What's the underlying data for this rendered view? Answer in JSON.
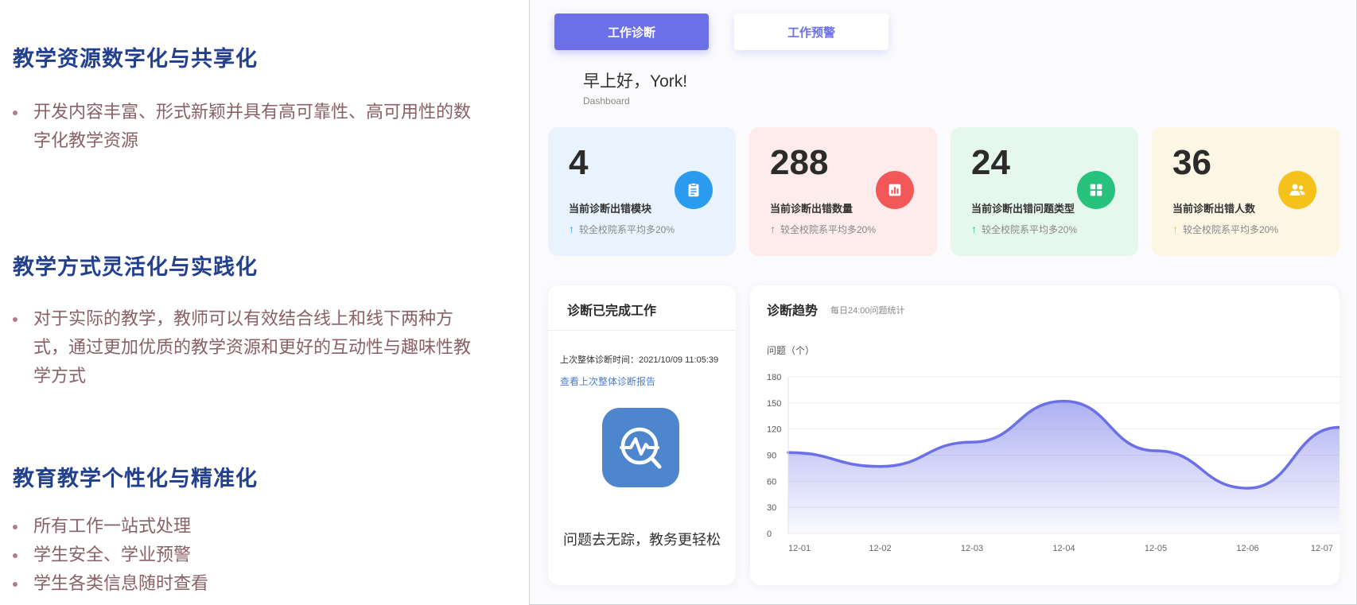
{
  "left": {
    "sections": [
      {
        "title": "教学资源数字化与共享化",
        "bullets": [
          "开发内容丰富、形式新颖并具有高可靠性、高可用性的数字化教学资源"
        ]
      },
      {
        "title": "教学方式灵活化与实践化",
        "bullets": [
          "对于实际的教学，教师可以有效结合线上和线下两种方式，通过更加优质的教学资源和更好的互动性与趣味性教学方式"
        ]
      },
      {
        "title": "教育教学个性化与精准化",
        "bullets": [
          "所有工作一站式处理",
          "学生安全、学业预警",
          "学生各类信息随时查看"
        ]
      }
    ]
  },
  "dashboard": {
    "tabs": [
      {
        "label": "工作诊断",
        "active": true
      },
      {
        "label": "工作预警",
        "active": false
      }
    ],
    "greeting": "早上好，York!",
    "greeting_sub": "Dashboard",
    "stats": [
      {
        "value": "4",
        "label": "当前诊断出错模块",
        "sub": "较全校院系平均多20%",
        "arrow": "↑",
        "icon": "clipboard-icon",
        "bg": "#e8f3fd",
        "accent": "#2b9bf0"
      },
      {
        "value": "288",
        "label": "当前诊断出错数量",
        "sub": "较全校院系平均多20%",
        "arrow": "↑",
        "icon": "bar-chart-icon",
        "bg": "#fdeceb",
        "accent": "#f25858"
      },
      {
        "value": "24",
        "label": "当前诊断出错问题类型",
        "sub": "较全校院系平均多20%",
        "arrow": "↑",
        "icon": "grid-icon",
        "bg": "#e6f7ee",
        "accent": "#27c27e"
      },
      {
        "value": "36",
        "label": "当前诊断出错人数",
        "sub": "较全校院系平均多20%",
        "arrow": "↑",
        "icon": "users-icon",
        "bg": "#fdf6e4",
        "accent": "#f5c21b"
      }
    ],
    "completed": {
      "title": "诊断已完成工作",
      "last_time": "上次整体诊断时间：2021/10/09  11:05:39",
      "link": "查看上次整体诊断报告",
      "icon": "diagnosis-icon",
      "slogan": "问题去无踪，教务更轻松"
    },
    "trend": {
      "title": "诊断趋势",
      "subtitle": "每日24:00问题统计"
    }
  },
  "colors": {
    "accent": "#6b70e8",
    "heading": "#23408e",
    "bullet_text": "#8a6068"
  },
  "chart_data": {
    "type": "area",
    "ylabel": "问题（个）",
    "categories": [
      "12-01",
      "12-02",
      "12-03",
      "12-04",
      "12-05",
      "12-06",
      "12-07"
    ],
    "values": [
      93,
      77,
      105,
      152,
      95,
      52,
      122
    ],
    "ylim": [
      0,
      180
    ],
    "yticks": [
      0,
      30,
      60,
      90,
      120,
      150,
      180
    ],
    "grid": true,
    "color": "#6b70e8"
  }
}
